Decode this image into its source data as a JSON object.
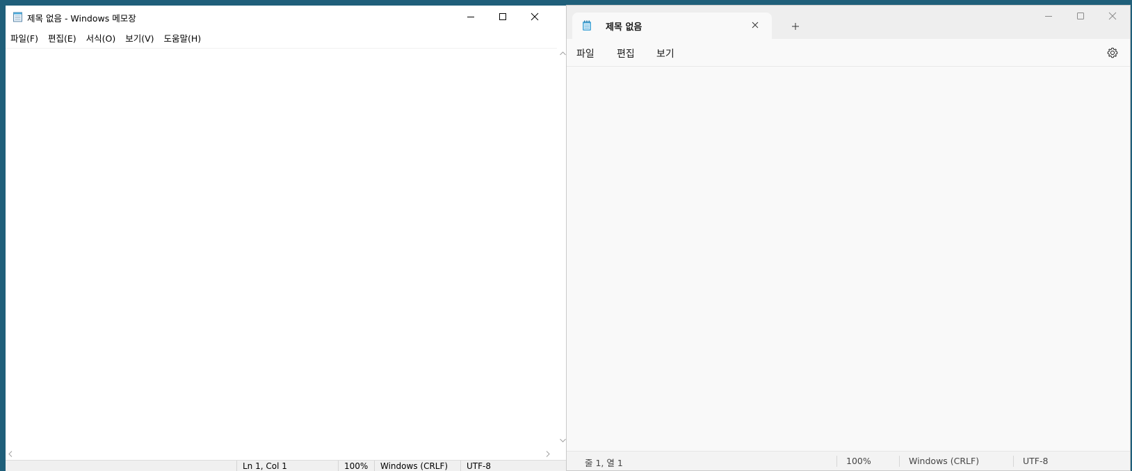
{
  "classic": {
    "title": "제목 없음 - Windows 메모장",
    "menu": [
      "파일(F)",
      "편집(E)",
      "서식(O)",
      "보기(V)",
      "도움말(H)"
    ],
    "status": {
      "position": "Ln 1, Col 1",
      "zoom": "100%",
      "line_ending": "Windows (CRLF)",
      "encoding": "UTF-8"
    }
  },
  "modern": {
    "tab_title": "제목 없음",
    "menu": [
      "파일",
      "편집",
      "보기"
    ],
    "status": {
      "position": "줄 1, 열 1",
      "zoom": "100%",
      "line_ending": "Windows (CRLF)",
      "encoding": "UTF-8"
    }
  },
  "colors": {
    "desktop": "#1f5f7a",
    "classic_status_bg": "#f0f0f0",
    "modern_bg": "#f9f9f9",
    "modern_tabstrip": "#eeeeee",
    "notepad_icon_blue": "#4aa8d8"
  },
  "icons": {
    "classic_app": "notepad-icon",
    "modern_tab": "notepad-icon",
    "settings": "gear-icon"
  }
}
